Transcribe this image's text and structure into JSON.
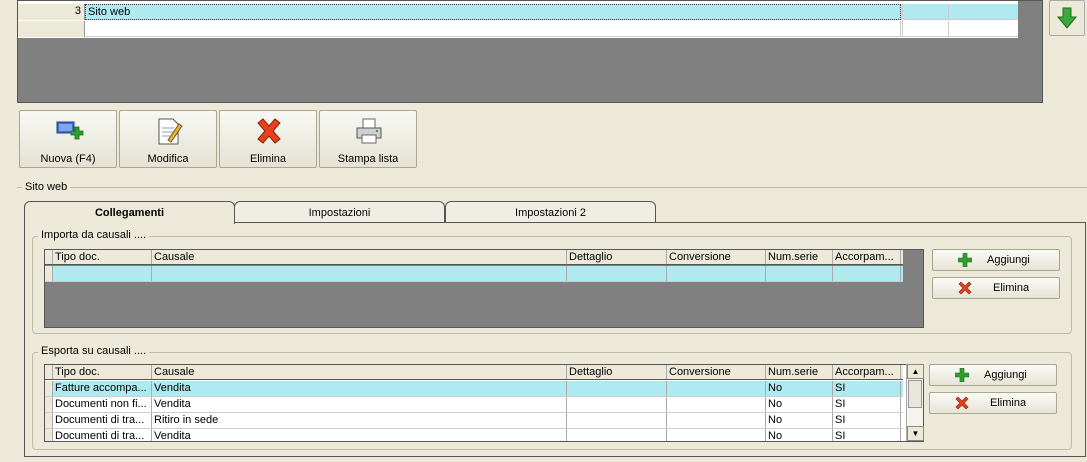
{
  "top_grid": {
    "rows": [
      {
        "index": "3",
        "name": "Sito web",
        "selected": true
      },
      {
        "index": "",
        "name": "",
        "selected": false
      }
    ]
  },
  "toolbar": {
    "new_label": "Nuova (F4)",
    "edit_label": "Modifica",
    "delete_label": "Elimina",
    "print_label": "Stampa lista"
  },
  "group": {
    "title": "Sito web"
  },
  "tabs": [
    {
      "label": "Collegamenti",
      "active": true
    },
    {
      "label": "Impostazioni",
      "active": false
    },
    {
      "label": "Impostazioni 2",
      "active": false
    }
  ],
  "import_section": {
    "title": "Importa da causali ....",
    "columns": [
      "Tipo doc.",
      "Causale",
      "Dettaglio",
      "Conversione",
      "Num.serie",
      "Accorpam..."
    ],
    "add_label": "Aggiungi",
    "delete_label": "Elimina"
  },
  "export_section": {
    "title": "Esporta su causali ....",
    "columns": [
      "Tipo doc.",
      "Causale",
      "Dettaglio",
      "Conversione",
      "Num.serie",
      "Accorpam..."
    ],
    "rows": [
      {
        "tipo": "Fatture accompa...",
        "causale": "Vendita",
        "dettaglio": "",
        "conversione": "",
        "num_serie": "No",
        "accorpam": "SI"
      },
      {
        "tipo": "Documenti non fi...",
        "causale": "Vendita",
        "dettaglio": "",
        "conversione": "",
        "num_serie": "No",
        "accorpam": "SI"
      },
      {
        "tipo": "Documenti di tra...",
        "causale": "Ritiro in sede",
        "dettaglio": "",
        "conversione": "",
        "num_serie": "No",
        "accorpam": "SI"
      },
      {
        "tipo": "Documenti di tra...",
        "causale": "Vendita",
        "dettaglio": "",
        "conversione": "",
        "num_serie": "No",
        "accorpam": "SI"
      }
    ],
    "add_label": "Aggiungi",
    "delete_label": "Elimina"
  },
  "colors": {
    "selection": "#aeeaf0",
    "add_icon": "#2e9e2e",
    "delete_icon": "#e8401c",
    "down_arrow": "#3aa83a"
  }
}
